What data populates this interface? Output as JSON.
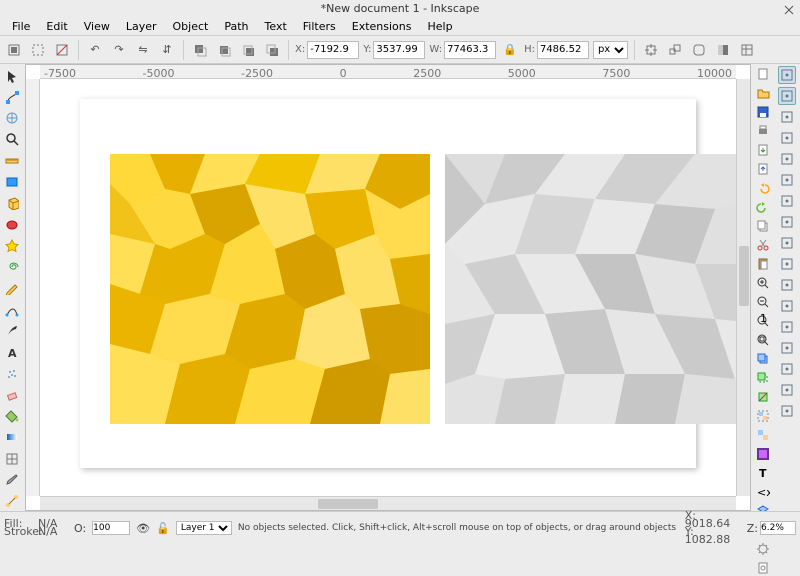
{
  "title": "*New document 1 - Inkscape",
  "menu": [
    "File",
    "Edit",
    "View",
    "Layer",
    "Object",
    "Path",
    "Text",
    "Filters",
    "Extensions",
    "Help"
  ],
  "toolbar": {
    "x_lbl": "X:",
    "x": "-7192.9",
    "y_lbl": "Y:",
    "y": "3537.99",
    "w_lbl": "W:",
    "w": "77463.3",
    "h_lbl": "H:",
    "h": "7486.52",
    "unit": "px"
  },
  "ruler_h": [
    "-7500",
    "-5000",
    "-2500",
    "0",
    "2500",
    "5000",
    "7500",
    "10000"
  ],
  "left_tools": [
    "arrow",
    "node",
    "tweak",
    "zoom",
    "measure",
    "rect",
    "3dbox",
    "ellipse",
    "star-poly",
    "spiral",
    "pencil",
    "bezier",
    "calligraphy",
    "text",
    "spray",
    "eraser",
    "bucket",
    "gradient",
    "mesh",
    "dropper",
    "connector"
  ],
  "cmd_tools": [
    "new",
    "open",
    "save",
    "print",
    "import",
    "export",
    "undo",
    "redo",
    "copy",
    "cut",
    "paste",
    "zoom-in",
    "zoom-out",
    "zoom-fit",
    "zoom-page",
    "duplicate",
    "clone",
    "unclone",
    "group",
    "ungroup",
    "fill-stroke",
    "text-tool",
    "xml",
    "layers",
    "align",
    "prefs",
    "doc-prefs"
  ],
  "snap_tools": [
    "snap-master",
    "snap-bbox",
    "snap-bbox-edge",
    "snap-bbox-corner",
    "snap-bbox-mid",
    "snap-node",
    "snap-path",
    "snap-intersect",
    "snap-cusp",
    "snap-smooth",
    "snap-line-mid",
    "snap-object-mid",
    "snap-rotation",
    "snap-text",
    "snap-page",
    "snap-grid",
    "snap-guide"
  ],
  "palette": [
    "#000000",
    "#1a1a1a",
    "#333333",
    "#4d4d4d",
    "#666666",
    "#808080",
    "#999999",
    "#b3b3b3",
    "#cccccc",
    "#e6e6e6",
    "#ffffff",
    "#330000",
    "#660000",
    "#800000",
    "#990000",
    "#cc0000",
    "#ff0000",
    "#ff3333",
    "#cc6600",
    "#ff6600",
    "#ff9933",
    "#ffcc00",
    "#ffff00",
    "#ccff33",
    "#99ff33",
    "#66cc00",
    "#339900",
    "#009900",
    "#006633",
    "#009999",
    "#00cccc",
    "#0099cc",
    "#0066cc",
    "#003399",
    "#000099",
    "#3300cc",
    "#6600cc",
    "#9900cc",
    "#cc0099",
    "#cc3399",
    "#ff66cc",
    "#ffcccc",
    "#ffe6cc",
    "#ffffcc",
    "#e6ffcc",
    "#ccffe6",
    "#ccffff",
    "#cce6ff",
    "#e6ccff",
    "#330033"
  ],
  "status": {
    "fill_lbl": "Fill:",
    "fill_val": "N/A",
    "stroke_lbl": "Stroke:",
    "stroke_val": "N/A",
    "opacity_lbl": "O:",
    "opacity": "100",
    "layer": "Layer 1",
    "hint": "No objects selected. Click, Shift+click, Alt+scroll mouse on top of objects, or drag around objects to select.",
    "x_lbl": "X:",
    "x": "9018.64",
    "y_lbl": "Y:",
    "y": "1082.88",
    "z_lbl": "Z:",
    "zoom": "6.2%"
  }
}
